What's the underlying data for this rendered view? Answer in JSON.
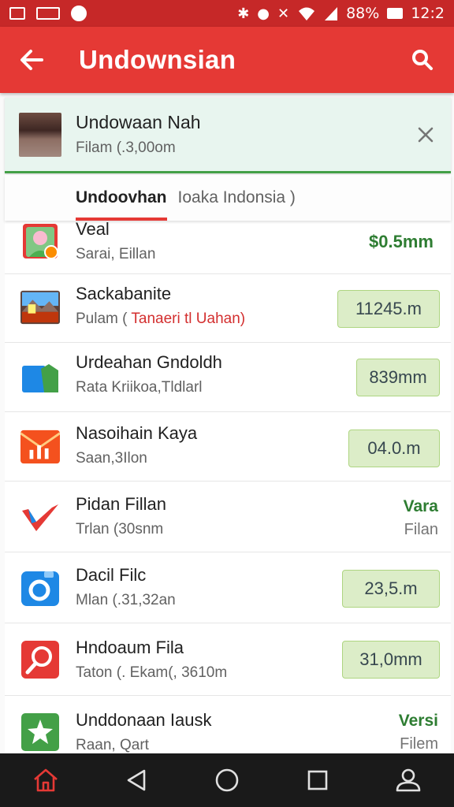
{
  "status_bar": {
    "battery": "88%",
    "time": "12:2"
  },
  "app_bar": {
    "title": "Undownsian",
    "back_icon": "arrow-back-icon",
    "search_icon": "search-icon"
  },
  "banner": {
    "name": "Undowaan Nah",
    "subtitle": "Filam (.3,00om"
  },
  "tabs": [
    {
      "label": "Undoovhan",
      "active": true
    },
    {
      "label": "Ioaka Indonsia )",
      "active": false
    }
  ],
  "list": [
    {
      "icon": "user-photo-icon",
      "title": "Veal",
      "subtitle": "Sarai, Eillan",
      "value": "$0.5mm",
      "value_style": "plain"
    },
    {
      "icon": "landscape-photo-icon",
      "title": "Sackabanite",
      "subtitle_prefix": "Pulam ( ",
      "subtitle_red": "Tanaeri tl Uahan)",
      "value": "11245.m",
      "value_style": "box"
    },
    {
      "icon": "folder-icon",
      "title": "Urdeahan Gndoldh",
      "subtitle": "Rata Kriikoa,Tldlarl",
      "value": "839mm",
      "value_style": "box"
    },
    {
      "icon": "chart-mail-icon",
      "title": "Nasoihain Kaya",
      "subtitle": "Saan,3Ilon",
      "value": "04.0.m",
      "value_style": "box"
    },
    {
      "icon": "checkmark-icon",
      "title": "Pidan Fillan",
      "subtitle": "Trlan (30snm",
      "value": "Vara",
      "value_secondary": "Filan",
      "value_style": "stack"
    },
    {
      "icon": "camera-icon",
      "title": "Dacil Filc",
      "subtitle": "Mlan (.31,32an",
      "value": "23,5.m",
      "value_style": "box"
    },
    {
      "icon": "magnifier-icon",
      "title": "Hndoaum Fila",
      "subtitle": "Taton (. Ekam(, 3610m",
      "value": "31,0mm",
      "value_style": "box"
    },
    {
      "icon": "star-badge-icon",
      "title": "Unddonaan Iausk",
      "subtitle": "Raan, Qart",
      "value": "Versi",
      "value_secondary": "Filem",
      "value_style": "stack"
    }
  ],
  "nav_bar": [
    "home-icon",
    "back-triangle-icon",
    "home-circle-icon",
    "recents-square-icon",
    "profile-icon"
  ],
  "colors": {
    "app_bar": "#e53935",
    "status_bar": "#c62828",
    "accent_green": "#2e7d32",
    "value_box": "#dcedc8"
  }
}
